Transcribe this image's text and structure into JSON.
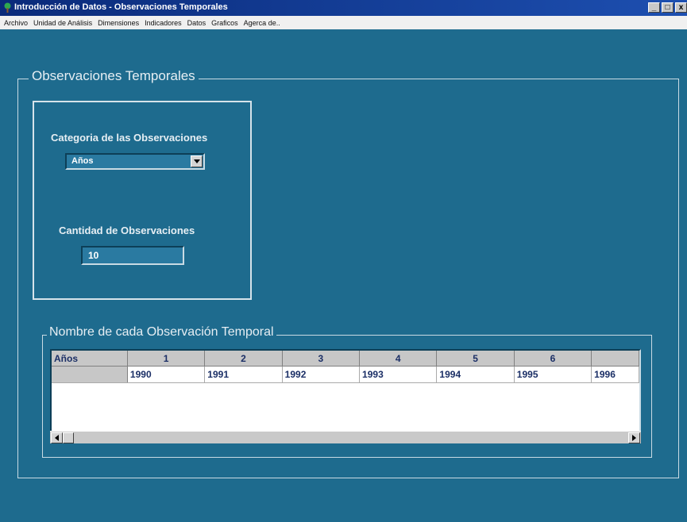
{
  "window": {
    "title": "Introducción de Datos - Observaciones Temporales",
    "controls": {
      "minimize": "_",
      "maximize": "□",
      "close": "x"
    }
  },
  "menubar": [
    {
      "label": "Archivo"
    },
    {
      "label": "Unidad de Análisis"
    },
    {
      "label": "Dimensiones"
    },
    {
      "label": "Indicadores"
    },
    {
      "label": "Datos"
    },
    {
      "label": "Graficos"
    },
    {
      "label": "Agerca de.."
    }
  ],
  "main": {
    "frame_title": "Observaciones Temporales",
    "category": {
      "label": "Categoria de las Observaciones",
      "selected": "Años"
    },
    "quantity": {
      "label": "Cantidad de Observaciones",
      "value": "10"
    }
  },
  "names_section": {
    "title": "Nombre de cada Observación Temporal",
    "corner_header": "Años",
    "column_headers": [
      "1",
      "2",
      "3",
      "4",
      "5",
      "6",
      ""
    ],
    "row_values": [
      "1990",
      "1991",
      "1992",
      "1993",
      "1994",
      "1995",
      "1996"
    ]
  },
  "colors": {
    "background": "#1e6b8e",
    "titlebar": "#0a2a7a"
  },
  "icons": [
    "app-icon",
    "chevron-down-icon",
    "arrow-left-icon",
    "arrow-right-icon"
  ]
}
